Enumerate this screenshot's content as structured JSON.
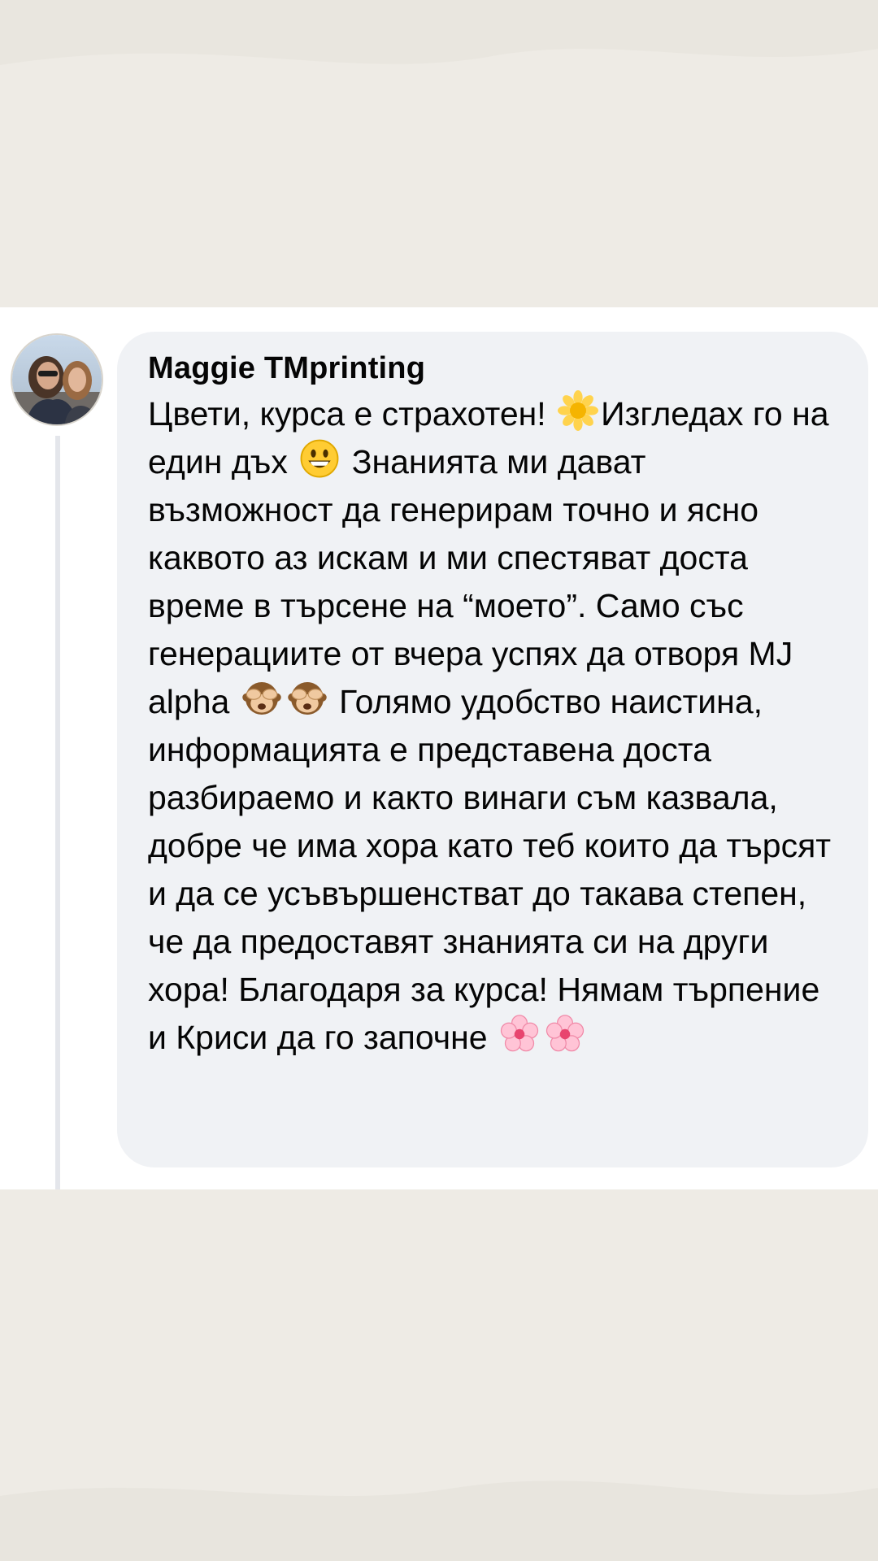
{
  "comment": {
    "author": "Maggie TMprinting",
    "text_parts": [
      "Цвети, курса е страхотен! ",
      "Изгледах го на един дъх ",
      " Знанията ми дават възможност да генерирам точно и ясно каквото аз искам и ми спестяват доста време в търсене на “моето”. Само със генерациите от вчера успях да отворя MJ alpha ",
      " Голямо удобство наистина, информацията е представена доста разбираемо и както винаги съм казвала, добре че има хора като теб които да търсят и да се усъвършенстват до такава степен, че да предоставят знанията си на други хора! Благодаря за курса! Нямам търпение и Криси да го започне "
    ],
    "emojis": [
      "blossom-icon",
      "grinning-face-icon",
      "see-no-evil-monkey-icon",
      "see-no-evil-monkey-icon",
      "cherry-blossom-icon",
      "cherry-blossom-icon"
    ]
  },
  "colors": {
    "background": "#eeebe5",
    "panel": "#ffffff",
    "bubble": "#f0f2f5",
    "text": "#050505"
  }
}
